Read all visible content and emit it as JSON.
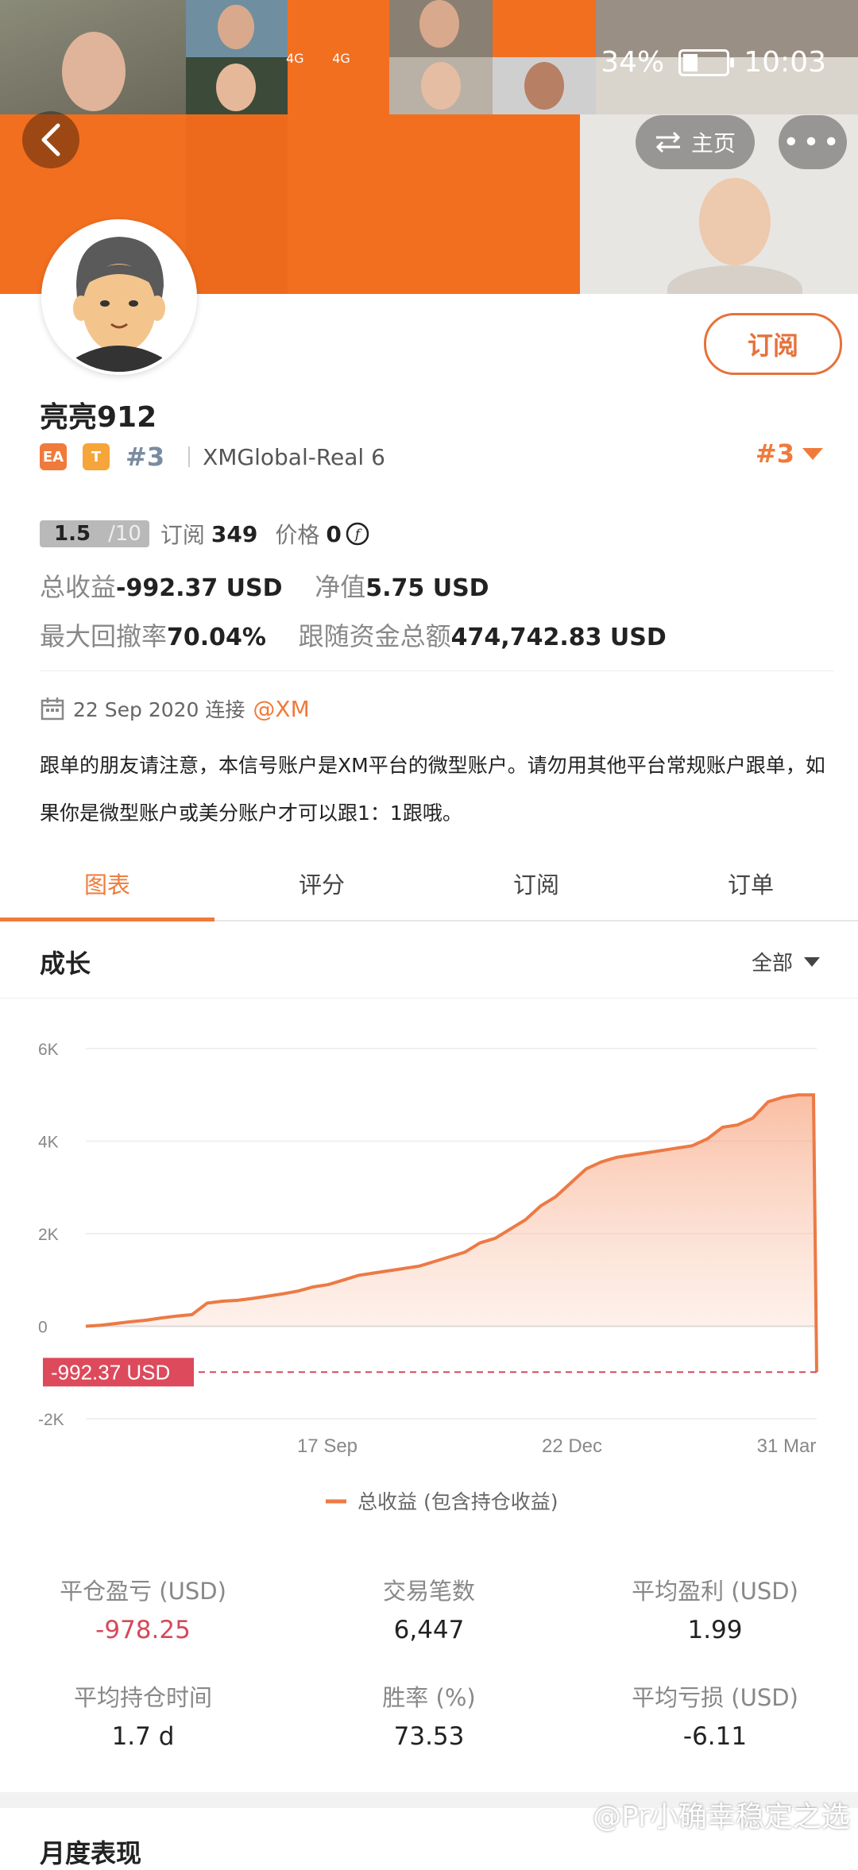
{
  "status": {
    "battery": "34%",
    "time": "10:03",
    "signal1": "4G",
    "signal2": "4G"
  },
  "nav": {
    "home_label": "主页",
    "more_label": "•••"
  },
  "profile": {
    "name": "亮亮912",
    "badge_ea": "EA",
    "badge_t": "T",
    "rank": "#3",
    "account": "XMGlobal-Real 6",
    "rank_right": "#3",
    "subscribe_label": "订阅"
  },
  "stats": {
    "score": "1.5",
    "score_max": "/10",
    "subs_label": "订阅",
    "subs_value": "349",
    "price_label": "价格",
    "price_value": "0",
    "total_label": "总收益",
    "total_value": "-992.37 USD",
    "equity_label": "净值",
    "equity_value": "5.75 USD",
    "drawdown_label": "最大回撤率",
    "drawdown_value": "70.04%",
    "follow_label": "跟随资金总额",
    "follow_value": "474,742.83 USD"
  },
  "connect": {
    "date": "22 Sep 2020 连接",
    "broker": "@XM"
  },
  "description": "跟单的朋友请注意，本信号账户是XM平台的微型账户。请勿用其他平台常规账户跟单，如果你是微型账户或美分账户才可以跟1：1跟哦。",
  "tabs": [
    "图表",
    "评分",
    "订阅",
    "订单"
  ],
  "growth": {
    "title": "成长",
    "filter": "全部"
  },
  "chart_data": {
    "type": "area",
    "y_ticks": [
      "6K",
      "4K",
      "2K",
      "0",
      "-2K"
    ],
    "ylim": [
      -2000,
      6000
    ],
    "x_ticks": [
      "17 Sep",
      "22 Dec",
      "31 Mar"
    ],
    "current_label": "-992.37 USD",
    "current_value": -992.37,
    "legend": "总收益 (包含持仓收益)",
    "series": [
      {
        "values": [
          0,
          20,
          60,
          100,
          130,
          180,
          220,
          250,
          500,
          540,
          560,
          600,
          650,
          700,
          760,
          850,
          900,
          1000,
          1100,
          1150,
          1200,
          1250,
          1300,
          1400,
          1500,
          1600,
          1800,
          1900,
          2100,
          2300,
          2600,
          2800,
          3100,
          3400,
          3550,
          3650,
          3700,
          3750,
          3800,
          3850,
          3900,
          4050,
          4300,
          4350,
          4500,
          4850,
          4950,
          5000,
          5000,
          -992.37
        ]
      }
    ]
  },
  "metrics": [
    {
      "label": "平仓盈亏 (USD)",
      "value": "-978.25",
      "red": true
    },
    {
      "label": "交易笔数",
      "value": "6,447"
    },
    {
      "label": "平均盈利 (USD)",
      "value": "1.99"
    },
    {
      "label": "平均持仓时间",
      "value": "1.7 d"
    },
    {
      "label": "胜率 (%)",
      "value": "73.53"
    },
    {
      "label": "平均亏损 (USD)",
      "value": "-6.11"
    }
  ],
  "monthly_title": "月度表现",
  "watermark": "@Pr小确幸稳定之选"
}
